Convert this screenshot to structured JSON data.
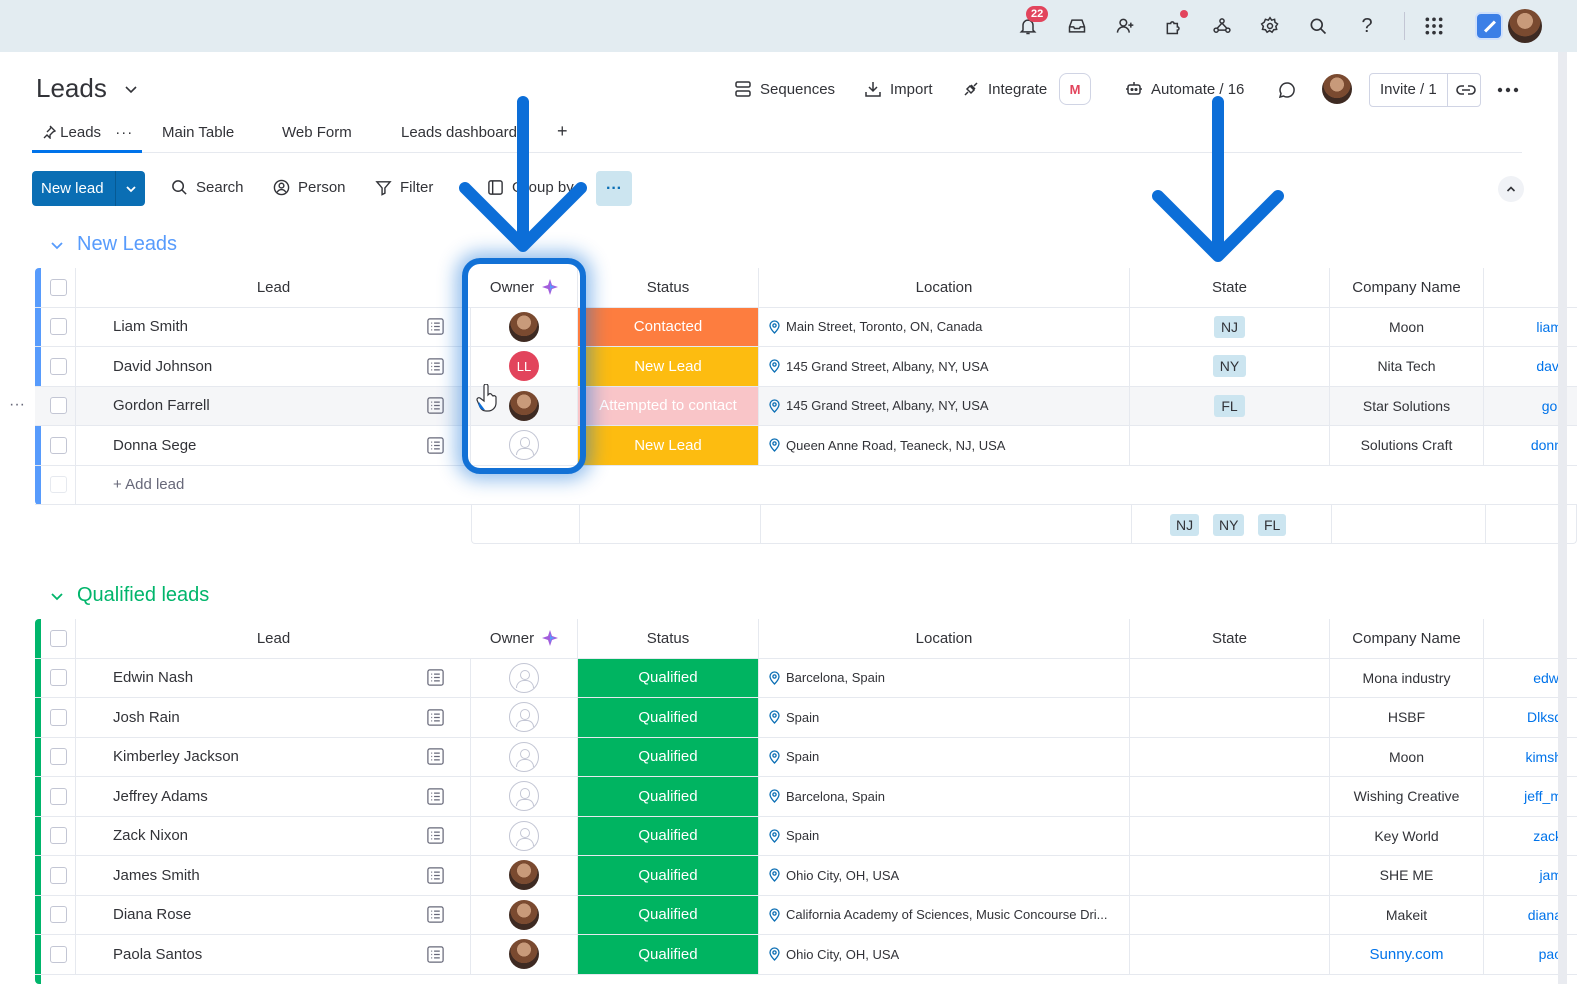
{
  "topbar": {
    "notification_count": "22",
    "icons": [
      "bell-icon",
      "inbox-icon",
      "invite-members-icon",
      "apps-icon",
      "integrations-icon",
      "settings-icon",
      "search-icon",
      "help-icon",
      "app-switcher-icon"
    ]
  },
  "header": {
    "board_title": "Leads",
    "actions": {
      "sequences": "Sequences",
      "import": "Import",
      "integrate": "Integrate",
      "integrate_badge": "M",
      "automate": "Automate / 16",
      "invite": "Invite / 1"
    }
  },
  "tabs": [
    {
      "label": "Leads",
      "active": true
    },
    {
      "label": "Main Table"
    },
    {
      "label": "Web Form"
    },
    {
      "label": "Leads dashboard"
    }
  ],
  "tab_add": "+",
  "toolbar": {
    "new_item": "New lead",
    "search": "Search",
    "person": "Person",
    "filter": "Filter",
    "group_by": "Group by",
    "more": "···"
  },
  "columns": {
    "lead": "Lead",
    "owner": "Owner",
    "status": "Status",
    "location": "Location",
    "state": "State",
    "company": "Company Name"
  },
  "groups": [
    {
      "title": "New Leads",
      "color": "#579bfc",
      "add_item": "+ Add lead",
      "summary_states": [
        "NJ",
        "NY",
        "FL"
      ],
      "rows": [
        {
          "lead": "Liam Smith",
          "owner": "photo",
          "status": "Contacted",
          "status_color": "#fd7d3f",
          "location": "Main Street, Toronto, ON, Canada",
          "state": "NJ",
          "company": "Moon",
          "email": "liam"
        },
        {
          "lead": "David Johnson",
          "owner": "LL",
          "status": "New Lead",
          "status_color": "#fdbc10",
          "location": "145 Grand Street, Albany, NY, USA",
          "state": "NY",
          "company": "Nita Tech",
          "email": "davi"
        },
        {
          "lead": "Gordon Farrell",
          "owner": "photo",
          "status": "Attempted to contact",
          "status_color": "#f9c5c8",
          "location": "145 Grand Street, Albany, NY, USA",
          "state": "FL",
          "company": "Star Solutions",
          "email": "gor"
        },
        {
          "lead": "Donna Sege",
          "owner": "empty",
          "status": "New Lead",
          "status_color": "#fdbc10",
          "location": "Queen Anne Road, Teaneck, NJ, USA",
          "state": "",
          "company": "Solutions Craft",
          "email": "donn"
        }
      ]
    },
    {
      "title": "Qualified leads",
      "color": "#00b56b",
      "rows": [
        {
          "lead": "Edwin Nash",
          "owner": "empty",
          "status": "Qualified",
          "status_color": "#00b461",
          "location": "Barcelona, Spain",
          "state": "",
          "company": "Mona industry",
          "email": "edwi"
        },
        {
          "lead": "Josh Rain",
          "owner": "empty",
          "status": "Qualified",
          "status_color": "#00b461",
          "location": "Spain",
          "state": "",
          "company": "HSBF",
          "email": "Dlksd"
        },
        {
          "lead": "Kimberley Jackson",
          "owner": "empty",
          "status": "Qualified",
          "status_color": "#00b461",
          "location": "Spain",
          "state": "",
          "company": "Moon",
          "email": "kimsh"
        },
        {
          "lead": "Jeffrey Adams",
          "owner": "empty",
          "status": "Qualified",
          "status_color": "#00b461",
          "location": "Barcelona, Spain",
          "state": "",
          "company": "Wishing Creative",
          "email": "jeff_m"
        },
        {
          "lead": "Zack Nixon",
          "owner": "empty",
          "status": "Qualified",
          "status_color": "#00b461",
          "location": "Spain",
          "state": "",
          "company": "Key World",
          "email": "zack"
        },
        {
          "lead": "James Smith",
          "owner": "photo",
          "status": "Qualified",
          "status_color": "#00b461",
          "location": "Ohio City, OH, USA",
          "state": "",
          "company": "SHE ME",
          "email": "jam"
        },
        {
          "lead": "Diana Rose",
          "owner": "photo",
          "status": "Qualified",
          "status_color": "#00b461",
          "location": "California Academy of Sciences, Music Concourse Dri...",
          "state": "",
          "company": "Makeit",
          "email": "diana"
        },
        {
          "lead": "Paola Santos",
          "owner": "photo",
          "status": "Qualified",
          "status_color": "#00b461",
          "location": "Ohio City, OH, USA",
          "state": "",
          "company": "Sunny.com",
          "email": "pao",
          "company_link": true
        }
      ]
    }
  ],
  "colors": {
    "primary": "#0a6eb4",
    "highlight": "#1271d6"
  }
}
